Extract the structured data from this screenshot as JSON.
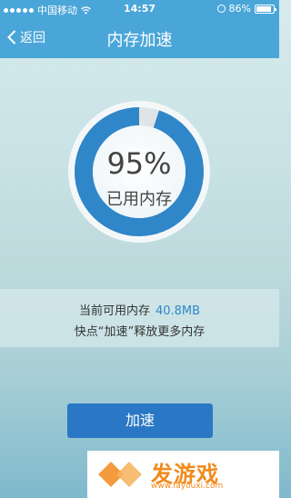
{
  "statusbar": {
    "carrier": "中国移动",
    "time": "14:57",
    "battery": "86%"
  },
  "navbar": {
    "back_label": "返回",
    "title": "内存加速"
  },
  "memory": {
    "percent_label": "95%",
    "percent_value": 95,
    "label": "已用内存"
  },
  "info": {
    "available_label": "当前可用内存",
    "available_value": "40.8MB",
    "hint": "快点“加速”释放更多内存"
  },
  "action": {
    "button_label": "加速"
  },
  "watermark": {
    "logo_text": "发游戏",
    "domain": "www.fayouxi.com"
  },
  "colors": {
    "accent": "#4aa6d8",
    "button": "#2a78c5",
    "ring": "#2f86c8",
    "watermark": "#f28a1c"
  }
}
